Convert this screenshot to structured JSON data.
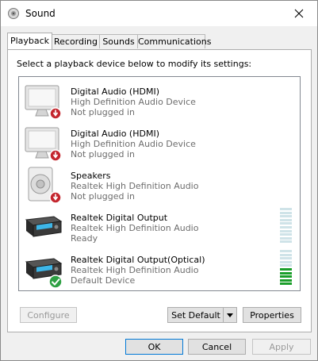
{
  "window": {
    "title": "Sound"
  },
  "tabs": [
    {
      "label": "Playback",
      "active": true
    },
    {
      "label": "Recording",
      "active": false
    },
    {
      "label": "Sounds",
      "active": false
    },
    {
      "label": "Communications",
      "active": false
    }
  ],
  "instruction": "Select a playback device below to modify its settings:",
  "devices": [
    {
      "name": "Digital Audio (HDMI)",
      "description": "High Definition Audio Device",
      "status": "Not plugged in",
      "icon": "monitor-icon",
      "badge": "unplugged-badge-icon"
    },
    {
      "name": "Digital Audio (HDMI)",
      "description": "High Definition Audio Device",
      "status": "Not plugged in",
      "icon": "monitor-icon",
      "badge": "unplugged-badge-icon"
    },
    {
      "name": "Speakers",
      "description": "Realtek High Definition Audio",
      "status": "Not plugged in",
      "icon": "speaker-icon",
      "badge": "unplugged-badge-icon"
    },
    {
      "name": "Realtek Digital Output",
      "description": "Realtek High Definition Audio",
      "status": "Ready",
      "icon": "receiver-icon",
      "level": 0
    },
    {
      "name": "Realtek Digital Output(Optical)",
      "description": "Realtek High Definition Audio",
      "status": "Default Device",
      "icon": "receiver-icon",
      "badge": "default-check-icon",
      "level": 0.5
    }
  ],
  "buttons": {
    "configure": "Configure",
    "set_default": "Set Default",
    "properties": "Properties",
    "ok": "OK",
    "cancel": "Cancel",
    "apply": "Apply"
  },
  "colors": {
    "unplugged": "#c4262e",
    "default_check": "#2ea043",
    "meter_on": "#1a9e2a",
    "meter_off": "#cfe3e8"
  }
}
